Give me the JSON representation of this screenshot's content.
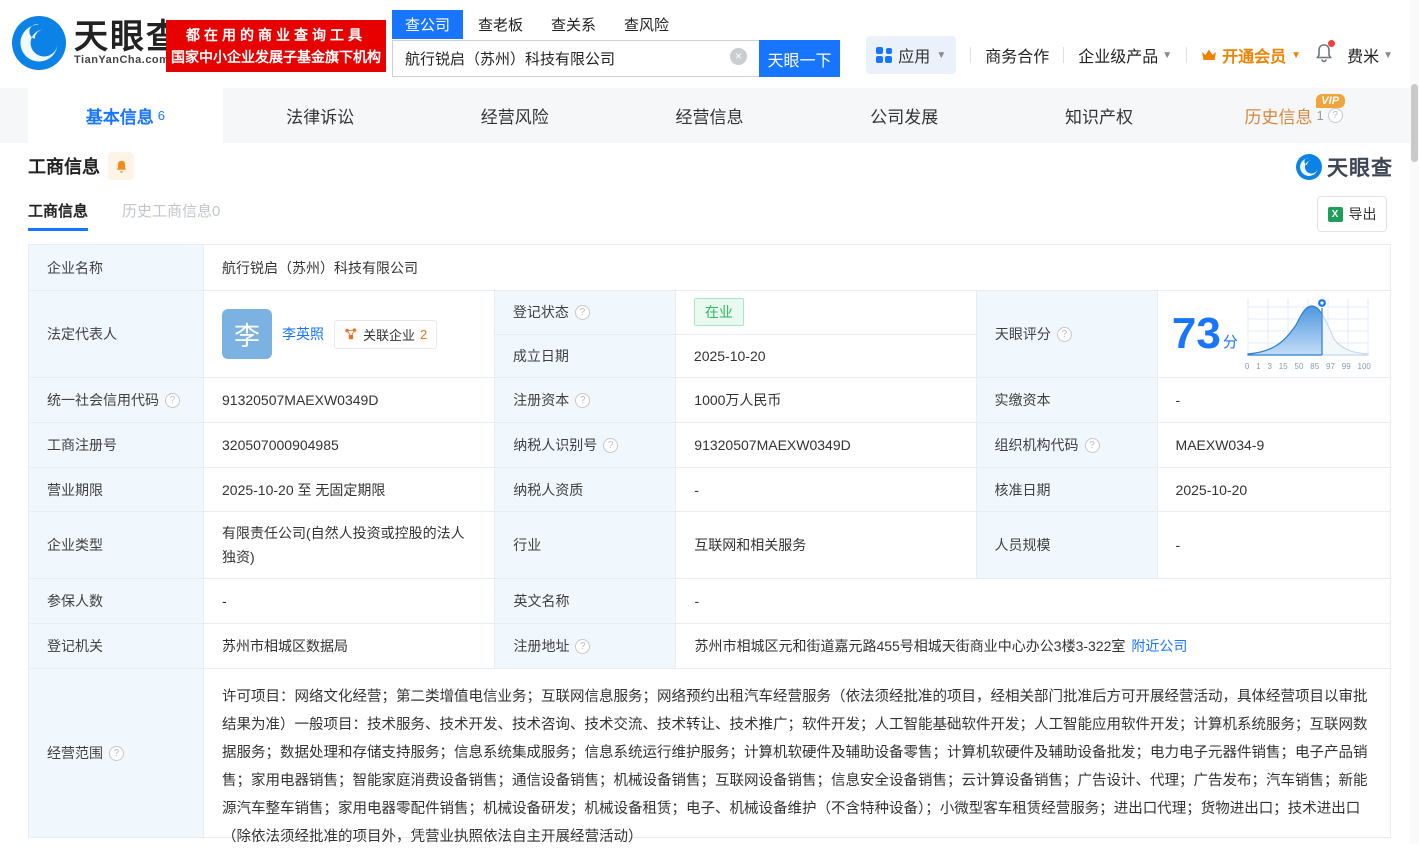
{
  "brand": {
    "name": "天眼查",
    "domain": "TianYanCha.com",
    "slogan_line1": "都在用的商业查询工具",
    "slogan_line2": "国家中小企业发展子基金旗下机构"
  },
  "search": {
    "tabs": [
      {
        "label": "查公司",
        "active": true
      },
      {
        "label": "查老板",
        "active": false
      },
      {
        "label": "查关系",
        "active": false
      },
      {
        "label": "查风险",
        "active": false
      }
    ],
    "query": "航行锐启（苏州）科技有限公司",
    "button": "天眼一下"
  },
  "topnav": {
    "apps": "应用",
    "items": [
      "商务合作",
      "企业级产品"
    ],
    "vip": "开通会员",
    "user": "费米"
  },
  "tabs": [
    {
      "label": "基本信息",
      "count": "6"
    },
    {
      "label": "法律诉讼"
    },
    {
      "label": "经营风险"
    },
    {
      "label": "经营信息"
    },
    {
      "label": "公司发展"
    },
    {
      "label": "知识产权"
    },
    {
      "label": "历史信息",
      "count": "1",
      "badge": "VIP"
    }
  ],
  "section": {
    "title": "工商信息",
    "subtabs": [
      {
        "label": "工商信息",
        "active": true
      },
      {
        "label": "历史工商信息0",
        "active": false
      }
    ],
    "export_label": "导出",
    "watermark": "天眼查"
  },
  "company": {
    "name_label": "企业名称",
    "name": "航行锐启（苏州）科技有限公司",
    "legal_rep_label": "法定代表人",
    "legal_rep_avatar": "李",
    "legal_rep_name": "李英照",
    "related_label": "关联企业",
    "related_count": "2"
  },
  "score": {
    "label": "天眼评分",
    "value": "73",
    "unit": "分",
    "axis": [
      "0",
      "1",
      "3",
      "15",
      "50",
      "85",
      "97",
      "99",
      "100"
    ]
  },
  "fields": {
    "reg_status": {
      "label": "登记状态",
      "value": "在业"
    },
    "established": {
      "label": "成立日期",
      "value": "2025-10-20"
    },
    "uscc": {
      "label": "统一社会信用代码",
      "value": "91320507MAEXW0349D"
    },
    "reg_capital": {
      "label": "注册资本",
      "value": "1000万人民币"
    },
    "paid_capital": {
      "label": "实缴资本",
      "value": "-"
    },
    "reg_number": {
      "label": "工商注册号",
      "value": "320507000904985"
    },
    "taxpayer_id": {
      "label": "纳税人识别号",
      "value": "91320507MAEXW0349D"
    },
    "org_code": {
      "label": "组织机构代码",
      "value": "MAEXW034-9"
    },
    "business_term": {
      "label": "营业期限",
      "value": "2025-10-20 至 无固定期限"
    },
    "taxpayer_quality": {
      "label": "纳税人资质",
      "value": "-"
    },
    "approval_date": {
      "label": "核准日期",
      "value": "2025-10-20"
    },
    "company_type": {
      "label": "企业类型",
      "value": "有限责任公司(自然人投资或控股的法人独资)"
    },
    "industry": {
      "label": "行业",
      "value": "互联网和相关服务"
    },
    "staff_size": {
      "label": "人员规模",
      "value": "-"
    },
    "insured_count": {
      "label": "参保人数",
      "value": "-"
    },
    "english_name": {
      "label": "英文名称",
      "value": "-"
    },
    "reg_authority": {
      "label": "登记机关",
      "value": "苏州市相城区数据局"
    },
    "reg_address": {
      "label": "注册地址",
      "value": "苏州市相城区元和街道嘉元路455号相城天街商业中心办公3楼3-322室",
      "link": "附近公司"
    },
    "business_scope": {
      "label": "经营范围",
      "value": "许可项目：网络文化经营；第二类增值电信业务；互联网信息服务；网络预约出租汽车经营服务（依法须经批准的项目，经相关部门批准后方可开展经营活动，具体经营项目以审批结果为准）一般项目：技术服务、技术开发、技术咨询、技术交流、技术转让、技术推广；软件开发；人工智能基础软件开发；人工智能应用软件开发；计算机系统服务；互联网数据服务；数据处理和存储支持服务；信息系统集成服务；信息系统运行维护服务；计算机软硬件及辅助设备零售；计算机软硬件及辅助设备批发；电力电子元器件销售；电子产品销售；家用电器销售；智能家庭消费设备销售；通信设备销售；机械设备销售；互联网设备销售；信息安全设备销售；云计算设备销售；广告设计、代理；广告发布；汽车销售；新能源汽车整车销售；家用电器零配件销售；机械设备研发；机械设备租赁；电子、机械设备维护（不含特种设备）；小微型客车租赁经营服务；进出口代理；货物进出口；技术进出口（除依法须经批准的项目外，凭营业执照依法自主开展经营活动）"
    }
  }
}
